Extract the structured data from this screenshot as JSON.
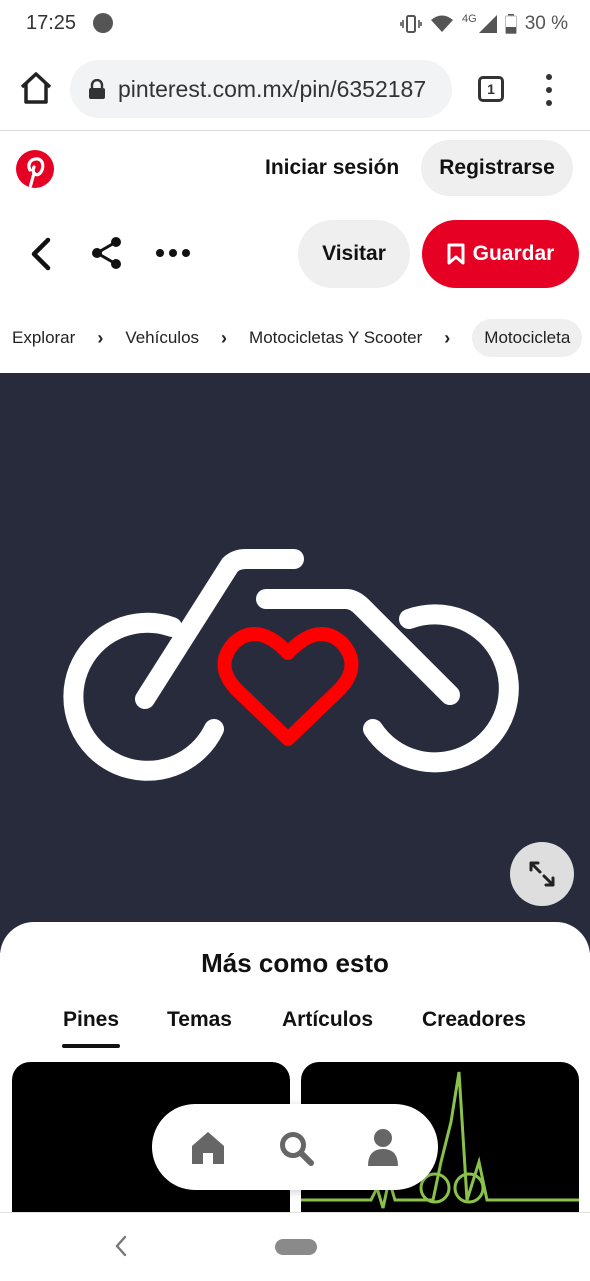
{
  "status_bar": {
    "time": "17:25",
    "network": "4G",
    "battery": "30 %",
    "icons": [
      "vibrate-icon",
      "wifi-icon",
      "signal-icon",
      "battery-icon"
    ]
  },
  "browser": {
    "url": "pinterest.com.mx/pin/6352187",
    "tab_count": "1"
  },
  "header": {
    "login_label": "Iniciar sesión",
    "register_label": "Registrarse",
    "brand_color": "#e60023"
  },
  "actions": {
    "visit_label": "Visitar",
    "save_label": "Guardar"
  },
  "breadcrumb": {
    "items": [
      "Explorar",
      "Vehículos",
      "Motocicletas Y Scooter",
      "Motocicleta"
    ]
  },
  "pin": {
    "background_color": "#272b3b",
    "heart_color": "#ff0000",
    "bike_color": "#ffffff"
  },
  "more_like_this": {
    "title": "Más como esto",
    "tabs": [
      "Pines",
      "Temas",
      "Artículos",
      "Creadores"
    ],
    "active_tab": "Pines"
  }
}
